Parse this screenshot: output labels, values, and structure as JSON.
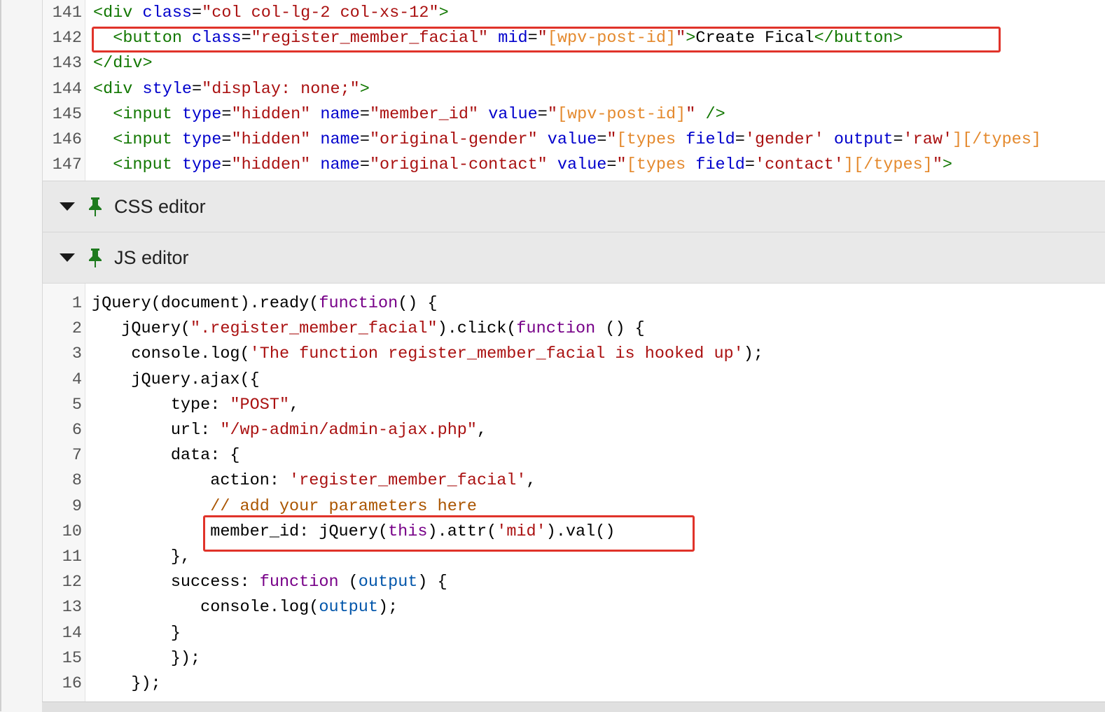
{
  "html_editor": {
    "lines": [
      {
        "n": "141",
        "tokens": [
          [
            "tag",
            "<div "
          ],
          [
            "attr",
            "class"
          ],
          [
            "txt",
            "="
          ],
          [
            "str",
            "\"col col-lg-2 col-xs-12\""
          ],
          [
            "tag",
            ">"
          ]
        ]
      },
      {
        "n": "142",
        "tokens": [
          [
            "txt",
            "  "
          ],
          [
            "tag",
            "<button "
          ],
          [
            "attr",
            "class"
          ],
          [
            "txt",
            "="
          ],
          [
            "str",
            "\"register_member_facial\""
          ],
          [
            "txt",
            " "
          ],
          [
            "attr",
            "mid"
          ],
          [
            "txt",
            "="
          ],
          [
            "str",
            "\""
          ],
          [
            "sc",
            "[wpv-post-id]"
          ],
          [
            "str",
            "\""
          ],
          [
            "tag",
            ">"
          ],
          [
            "txt",
            "Create Fical"
          ],
          [
            "tag",
            "</button>"
          ]
        ]
      },
      {
        "n": "143",
        "tokens": [
          [
            "tag",
            "</div>"
          ]
        ]
      },
      {
        "n": "144",
        "tokens": [
          [
            "tag",
            "<div "
          ],
          [
            "attr",
            "style"
          ],
          [
            "txt",
            "="
          ],
          [
            "str",
            "\"display: none;\""
          ],
          [
            "tag",
            ">"
          ]
        ]
      },
      {
        "n": "145",
        "tokens": [
          [
            "txt",
            "  "
          ],
          [
            "tag",
            "<input "
          ],
          [
            "attr",
            "type"
          ],
          [
            "txt",
            "="
          ],
          [
            "str",
            "\"hidden\""
          ],
          [
            "txt",
            " "
          ],
          [
            "attr",
            "name"
          ],
          [
            "txt",
            "="
          ],
          [
            "str",
            "\"member_id\""
          ],
          [
            "txt",
            " "
          ],
          [
            "attr",
            "value"
          ],
          [
            "txt",
            "="
          ],
          [
            "str",
            "\""
          ],
          [
            "sc",
            "[wpv-post-id]"
          ],
          [
            "str",
            "\""
          ],
          [
            "txt",
            " "
          ],
          [
            "tag",
            "/>"
          ]
        ]
      },
      {
        "n": "146",
        "tokens": [
          [
            "txt",
            "  "
          ],
          [
            "tag",
            "<input "
          ],
          [
            "attr",
            "type"
          ],
          [
            "txt",
            "="
          ],
          [
            "str",
            "\"hidden\""
          ],
          [
            "txt",
            " "
          ],
          [
            "attr",
            "name"
          ],
          [
            "txt",
            "="
          ],
          [
            "str",
            "\"original-gender\""
          ],
          [
            "txt",
            " "
          ],
          [
            "attr",
            "value"
          ],
          [
            "txt",
            "="
          ],
          [
            "str",
            "\""
          ],
          [
            "sc",
            "[types "
          ],
          [
            "attr",
            "field"
          ],
          [
            "txt",
            "="
          ],
          [
            "str",
            "'gender'"
          ],
          [
            "txt",
            " "
          ],
          [
            "attr",
            "output"
          ],
          [
            "txt",
            "="
          ],
          [
            "str",
            "'raw'"
          ],
          [
            "sc",
            "][/types]"
          ]
        ]
      },
      {
        "n": "147",
        "tokens": [
          [
            "txt",
            "  "
          ],
          [
            "tag",
            "<input "
          ],
          [
            "attr",
            "type"
          ],
          [
            "txt",
            "="
          ],
          [
            "str",
            "\"hidden\""
          ],
          [
            "txt",
            " "
          ],
          [
            "attr",
            "name"
          ],
          [
            "txt",
            "="
          ],
          [
            "str",
            "\"original-contact\""
          ],
          [
            "txt",
            " "
          ],
          [
            "attr",
            "value"
          ],
          [
            "txt",
            "="
          ],
          [
            "str",
            "\""
          ],
          [
            "sc",
            "[types "
          ],
          [
            "attr",
            "field"
          ],
          [
            "txt",
            "="
          ],
          [
            "str",
            "'contact'"
          ],
          [
            "sc",
            "][/types]"
          ],
          [
            "str",
            "\""
          ],
          [
            "tag",
            ">"
          ]
        ]
      }
    ]
  },
  "panels": {
    "css_label": "CSS editor",
    "js_label": "JS editor"
  },
  "js_editor": {
    "lines": [
      {
        "n": "1",
        "tokens": [
          [
            "txt",
            "jQuery(document).ready("
          ],
          [
            "kw",
            "function"
          ],
          [
            "txt",
            "() {"
          ]
        ]
      },
      {
        "n": "2",
        "tokens": [
          [
            "txt",
            "   jQuery("
          ],
          [
            "str",
            "\".register_member_facial\""
          ],
          [
            "txt",
            ").click("
          ],
          [
            "kw",
            "function"
          ],
          [
            "txt",
            " () {"
          ]
        ]
      },
      {
        "n": "3",
        "tokens": [
          [
            "txt",
            "    console.log("
          ],
          [
            "str",
            "'The function register_member_facial is hooked up'"
          ],
          [
            "txt",
            ");"
          ]
        ]
      },
      {
        "n": "4",
        "tokens": [
          [
            "txt",
            "    jQuery.ajax({"
          ]
        ]
      },
      {
        "n": "5",
        "tokens": [
          [
            "txt",
            "        type: "
          ],
          [
            "str",
            "\"POST\""
          ],
          [
            "txt",
            ","
          ]
        ]
      },
      {
        "n": "6",
        "tokens": [
          [
            "txt",
            "        url: "
          ],
          [
            "str",
            "\"/wp-admin/admin-ajax.php\""
          ],
          [
            "txt",
            ","
          ]
        ]
      },
      {
        "n": "7",
        "tokens": [
          [
            "txt",
            "        data: {"
          ]
        ]
      },
      {
        "n": "8",
        "tokens": [
          [
            "txt",
            "            action: "
          ],
          [
            "str",
            "'register_member_facial'"
          ],
          [
            "txt",
            ","
          ]
        ]
      },
      {
        "n": "9",
        "tokens": [
          [
            "txt",
            "            "
          ],
          [
            "cm",
            "// add your parameters here"
          ]
        ]
      },
      {
        "n": "10",
        "tokens": [
          [
            "txt",
            "            member_id: jQuery("
          ],
          [
            "kw",
            "this"
          ],
          [
            "txt",
            ").attr("
          ],
          [
            "str",
            "'mid'"
          ],
          [
            "txt",
            ").val()"
          ]
        ]
      },
      {
        "n": "11",
        "tokens": [
          [
            "txt",
            "        },"
          ]
        ]
      },
      {
        "n": "12",
        "tokens": [
          [
            "txt",
            "        success: "
          ],
          [
            "kw",
            "function"
          ],
          [
            "txt",
            " ("
          ],
          [
            "var",
            "output"
          ],
          [
            "txt",
            ") {"
          ]
        ]
      },
      {
        "n": "13",
        "tokens": [
          [
            "txt",
            "           console.log("
          ],
          [
            "var",
            "output"
          ],
          [
            "txt",
            ");"
          ]
        ]
      },
      {
        "n": "14",
        "tokens": [
          [
            "txt",
            "        }"
          ]
        ]
      },
      {
        "n": "15",
        "tokens": [
          [
            "txt",
            "        });"
          ]
        ]
      },
      {
        "n": "16",
        "tokens": [
          [
            "txt",
            "    });"
          ]
        ]
      }
    ]
  },
  "colors": {
    "highlight_box": "#e0332a",
    "pin_icon": "#1e7a1e"
  }
}
